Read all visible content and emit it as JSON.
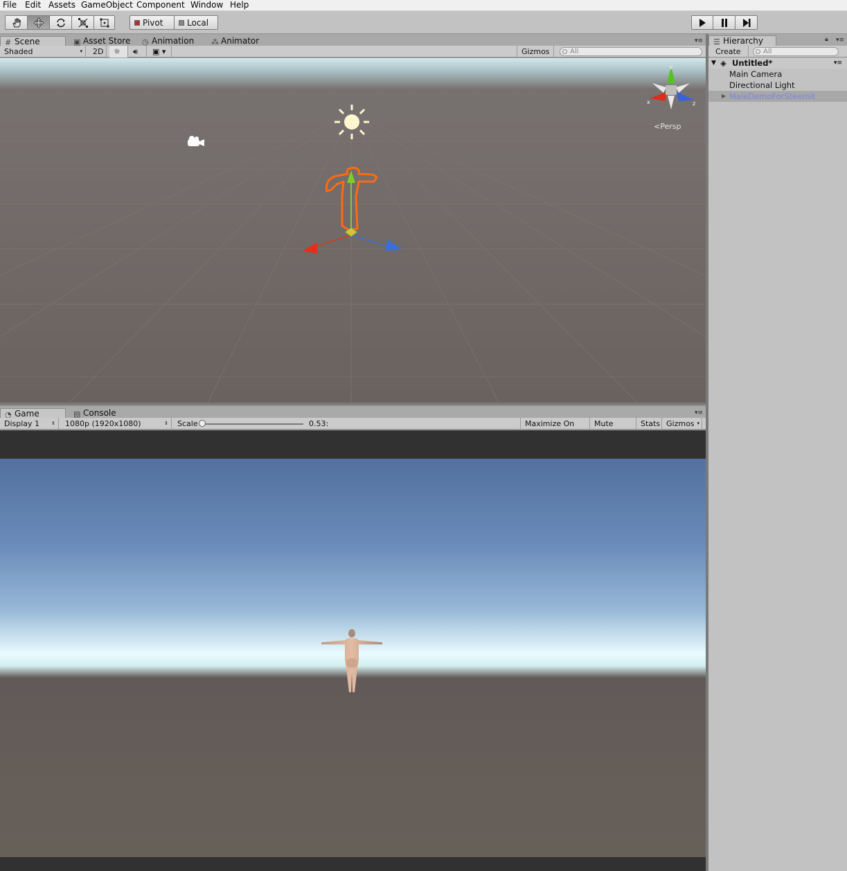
{
  "menubar": [
    "File",
    "Edit",
    "Assets",
    "GameObject",
    "Component",
    "Window",
    "Help"
  ],
  "toolbar": {
    "tools": [
      "hand-tool",
      "move-tool",
      "rotate-tool",
      "scale-tool",
      "rect-tool"
    ],
    "pivot_label": "Pivot",
    "local_label": "Local"
  },
  "top_tabs": [
    "Scene",
    "Asset Store",
    "Animation",
    "Animator"
  ],
  "scene_bar": {
    "shading": "Shaded",
    "mode2d": "2D",
    "gizmos": "Gizmos",
    "search_placeholder": "All"
  },
  "scene_view": {
    "projection": "Persp",
    "axis_labels": [
      "y",
      "x",
      "z"
    ]
  },
  "game_tabs": [
    "Game",
    "Console"
  ],
  "game_bar": {
    "display": "Display 1",
    "resolution": "1080p (1920x1080)",
    "scale_label": "Scale",
    "scale_value": "0.53:",
    "scale_fraction": 0.0,
    "maximize": "Maximize On Play",
    "mute": "Mute Audio",
    "stats": "Stats",
    "gizmos": "Gizmos"
  },
  "hierarchy": {
    "tab": "Hierarchy",
    "create": "Create",
    "search_placeholder": "All",
    "scene": "Untitled*",
    "items": [
      "Main Camera",
      "Directional Light",
      "MaleDemoForSteemit"
    ]
  },
  "colors": {
    "selected_item": "#7886e0",
    "orange_outline": "#ff6a10"
  }
}
